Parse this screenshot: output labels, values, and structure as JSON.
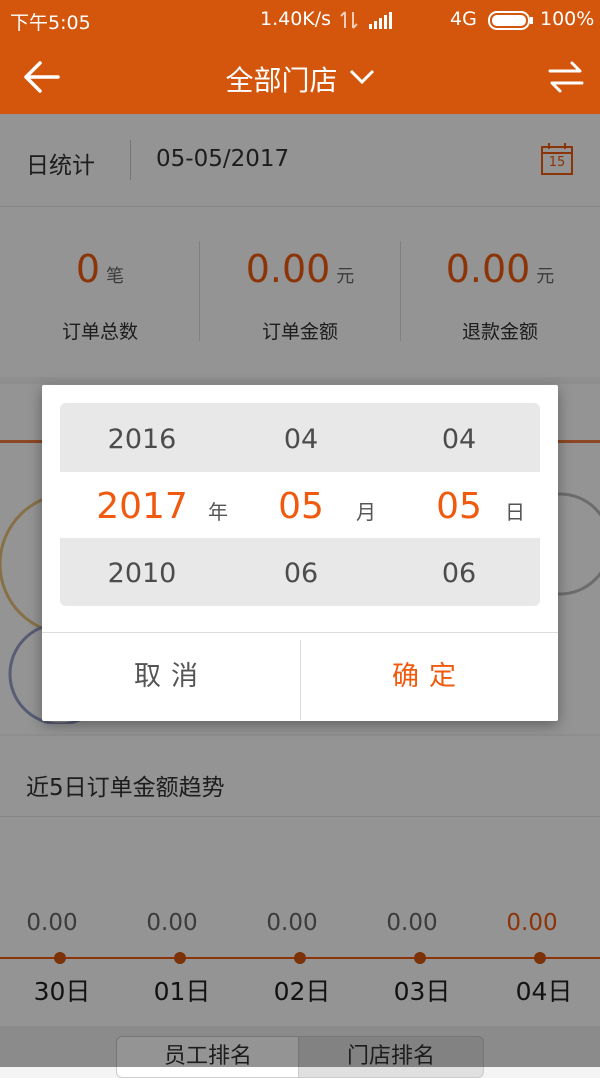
{
  "status_bar": {
    "time": "下午5:05",
    "network_speed": "1.40K/s",
    "network_type": "4G",
    "battery": "100%"
  },
  "header": {
    "title": "全部门店",
    "back_icon": "back-arrow-icon",
    "switch_icon": "switch-arrows-icon"
  },
  "date_bar": {
    "mode": "日统计",
    "date": "05-05/2017",
    "calendar_day": "15"
  },
  "stats": [
    {
      "value": "0",
      "unit": "笔",
      "label": "订单总数"
    },
    {
      "value": "0.00",
      "unit": "元",
      "label": "订单金额"
    },
    {
      "value": "0.00",
      "unit": "元",
      "label": "退款金额"
    }
  ],
  "date_picker": {
    "years": {
      "prev": "2016",
      "selected": "2017",
      "next": "2010",
      "unit": "年"
    },
    "months": {
      "prev": "04",
      "selected": "05",
      "next": "06",
      "unit": "月"
    },
    "days": {
      "prev": "04",
      "selected": "05",
      "next": "06",
      "unit": "日"
    },
    "cancel_label": "取消",
    "confirm_label": "确定"
  },
  "trend": {
    "title": "近5日订单金额趋势",
    "points": [
      {
        "value": "0.00",
        "day": "30日",
        "highlight": false
      },
      {
        "value": "0.00",
        "day": "01日",
        "highlight": false
      },
      {
        "value": "0.00",
        "day": "02日",
        "highlight": false
      },
      {
        "value": "0.00",
        "day": "03日",
        "highlight": false
      },
      {
        "value": "0.00",
        "day": "04日",
        "highlight": true
      }
    ]
  },
  "bottom_tabs": [
    {
      "label": "员工排名",
      "active": true
    },
    {
      "label": "门店排名",
      "active": false
    }
  ],
  "colors": {
    "brand": "#d4560c",
    "accent": "#f05a0f"
  }
}
